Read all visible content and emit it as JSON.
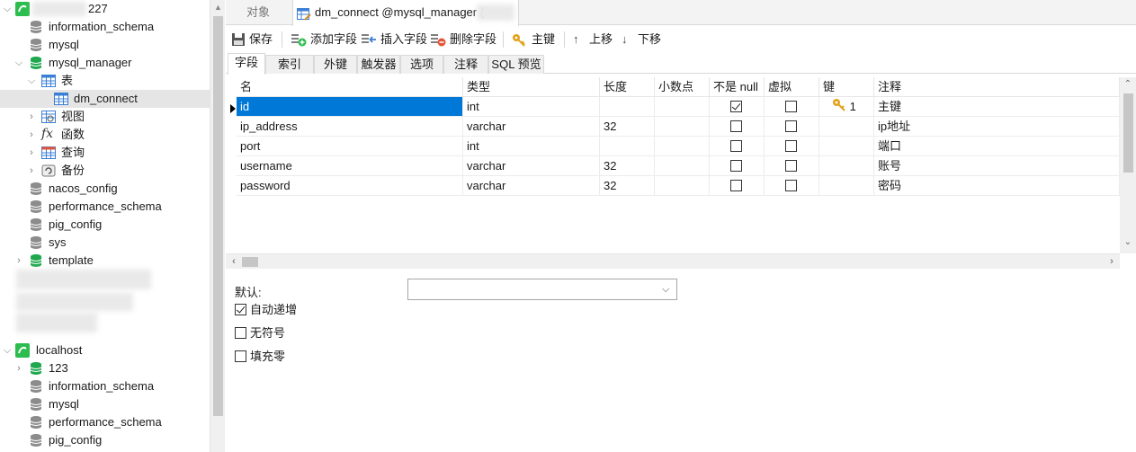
{
  "tree": {
    "conn1_suffix": "227",
    "db_information_schema": "information_schema",
    "db_mysql": "mysql",
    "db_mysql_manager": "mysql_manager",
    "folder_tables": "表",
    "table_dm_connect": "dm_connect",
    "folder_views": "视图",
    "folder_functions": "函数",
    "folder_queries": "查询",
    "folder_backups": "备份",
    "db_nacos_config": "nacos_config",
    "db_performance_schema": "performance_schema",
    "db_pig_config": "pig_config",
    "db_sys": "sys",
    "db_template": "template",
    "conn_localhost": "localhost",
    "lh_db_123": "123",
    "lh_db_information_schema": "information_schema",
    "lh_db_mysql": "mysql",
    "lh_db_performance_schema": "performance_schema",
    "lh_db_pig_config": "pig_config"
  },
  "tabs": {
    "objects": "对象",
    "connection": "dm_connect @mysql_manager ("
  },
  "toolbar": {
    "save": "保存",
    "add_field": "添加字段",
    "insert_field": "插入字段",
    "delete_field": "删除字段",
    "primary_key": "主键",
    "move_up": "上移",
    "move_down": "下移"
  },
  "subtabs": [
    "字段",
    "索引",
    "外键",
    "触发器",
    "选项",
    "注释",
    "SQL 预览"
  ],
  "grid": {
    "headers": [
      "名",
      "类型",
      "长度",
      "小数点",
      "不是 null",
      "虚拟",
      "键",
      "注释"
    ],
    "rows": [
      {
        "name": "id",
        "type": "int",
        "length": "",
        "decimals": "",
        "not_null": true,
        "virtual": false,
        "key": "1",
        "comment": "主键"
      },
      {
        "name": "ip_address",
        "type": "varchar",
        "length": "32",
        "decimals": "",
        "not_null": false,
        "virtual": false,
        "key": "",
        "comment": "ip地址"
      },
      {
        "name": "port",
        "type": "int",
        "length": "",
        "decimals": "",
        "not_null": false,
        "virtual": false,
        "key": "",
        "comment": "端口"
      },
      {
        "name": "username",
        "type": "varchar",
        "length": "32",
        "decimals": "",
        "not_null": false,
        "virtual": false,
        "key": "",
        "comment": "账号"
      },
      {
        "name": "password",
        "type": "varchar",
        "length": "32",
        "decimals": "",
        "not_null": false,
        "virtual": false,
        "key": "",
        "comment": "密码"
      }
    ]
  },
  "props": {
    "default_label": "默认:",
    "default_value": "",
    "auto_increment": "自动递增",
    "auto_increment_checked": true,
    "unsigned": "无符号",
    "unsigned_checked": false,
    "zerofill": "填充零",
    "zerofill_checked": false
  },
  "colors": {
    "selection": "#0078d7",
    "db_green": "#1fa84f",
    "table_blue": "#3b7fd4",
    "conn_green": "#2dbd4e"
  }
}
